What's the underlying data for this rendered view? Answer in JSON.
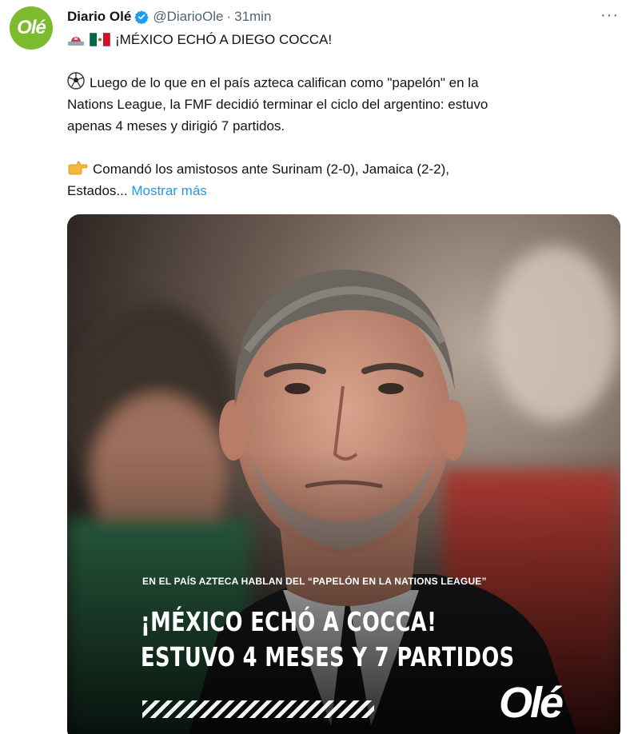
{
  "tweet": {
    "avatar_text": "Olé",
    "display_name": "Diario Olé",
    "handle": "@DiarioOle",
    "separator": "·",
    "time": "31min",
    "more_label": "···",
    "line1": "¡MÉXICO ECHÓ A DIEGO COCCA!",
    "line2": "Luego de lo que en el país azteca califican como \"papelón\" en la",
    "line3": "Nations League, la FMF decidió terminar el ciclo del argentino: estuvo",
    "line4": "apenas 4 meses y dirigió 7 partidos.",
    "line5": "Comandó los amistosos ante Surinam (2-0), Jamaica (2-2),",
    "line6": "Estados...",
    "show_more": "Mostrar más"
  },
  "media": {
    "kicker": "EN EL PAÍS AZTECA HABLAN DEL “PAPELÓN EN LA NATIONS LEAGUE”",
    "headline1": "¡MÉXICO ECHÓ A COCCA!",
    "headline2": "ESTUVO 4 MESES Y 7 PARTIDOS",
    "wordmark": "Olé"
  },
  "icons": {
    "verified": "verified-badge-icon",
    "more": "more-horizontal-icon",
    "siren": "siren-emoji-icon",
    "flag": "mexico-flag-emoji-icon",
    "ball": "soccer-ball-emoji-icon",
    "pointing": "pointing-right-emoji-icon"
  },
  "colors": {
    "link": "#1d9bf0",
    "brand": "#7dbb2e",
    "text": "#0f1419",
    "meta": "#536471"
  }
}
